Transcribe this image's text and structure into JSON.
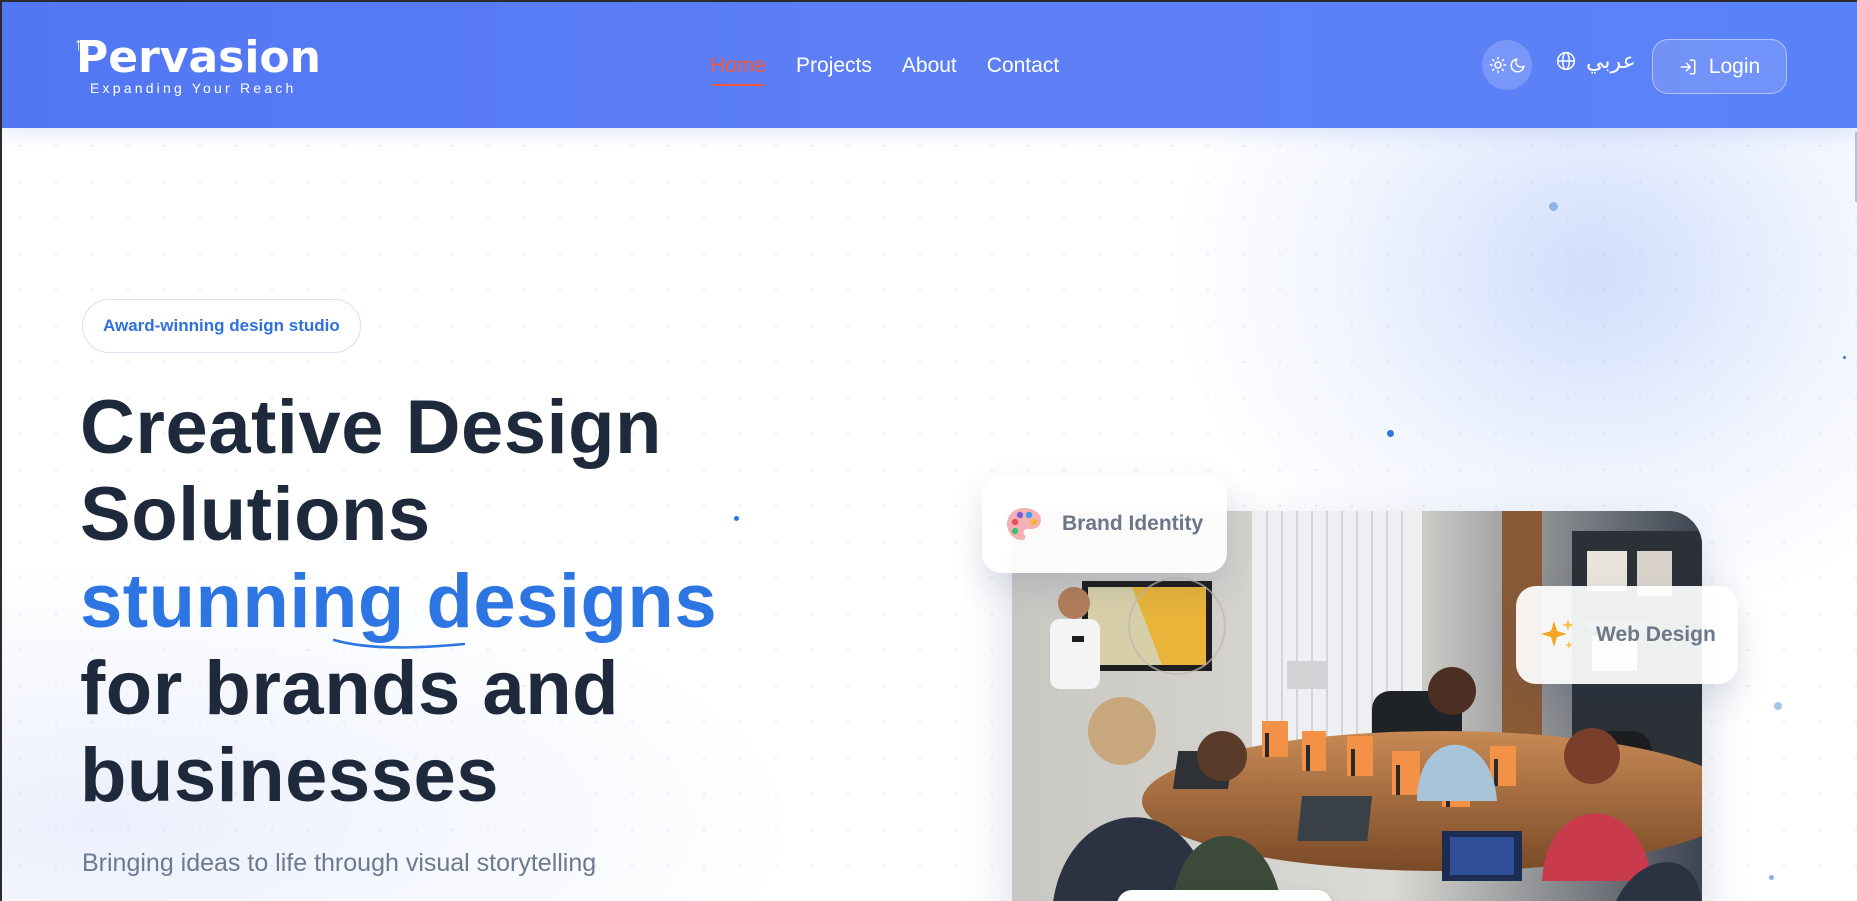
{
  "navbar": {
    "logo": {
      "name": "Pervasion",
      "tagline": "Expanding Your Reach"
    },
    "links": [
      {
        "label": "Home",
        "active": true
      },
      {
        "label": "Projects",
        "active": false
      },
      {
        "label": "About",
        "active": false
      },
      {
        "label": "Contact",
        "active": false
      }
    ],
    "theme_toggle_icons": [
      "sun-icon",
      "moon-icon"
    ],
    "language": {
      "label": "عربي",
      "icon": "globe-icon"
    },
    "login": {
      "label": "Login",
      "icon": "login-icon"
    }
  },
  "hero": {
    "badge": "Award-winning design studio",
    "title_lines": [
      "Creative Design",
      "Solutions"
    ],
    "title_accent": "stunning designs",
    "title_rest": [
      "for brands and",
      "businesses"
    ],
    "subtitle": "Bringing ideas to life through visual storytelling"
  },
  "floating_cards": [
    {
      "label": "Brand Identity",
      "icon": "palette-icon"
    },
    {
      "label": "Web Design",
      "icon": "sparkles-icon"
    }
  ],
  "colors": {
    "nav_gradient_start": "#5277f4",
    "nav_gradient_end": "#5a82f8",
    "active_link": "#f25a38",
    "accent_blue": "#2d75e2",
    "title_dark": "#1e2a3c",
    "subtitle_gray": "#6b7a90"
  }
}
